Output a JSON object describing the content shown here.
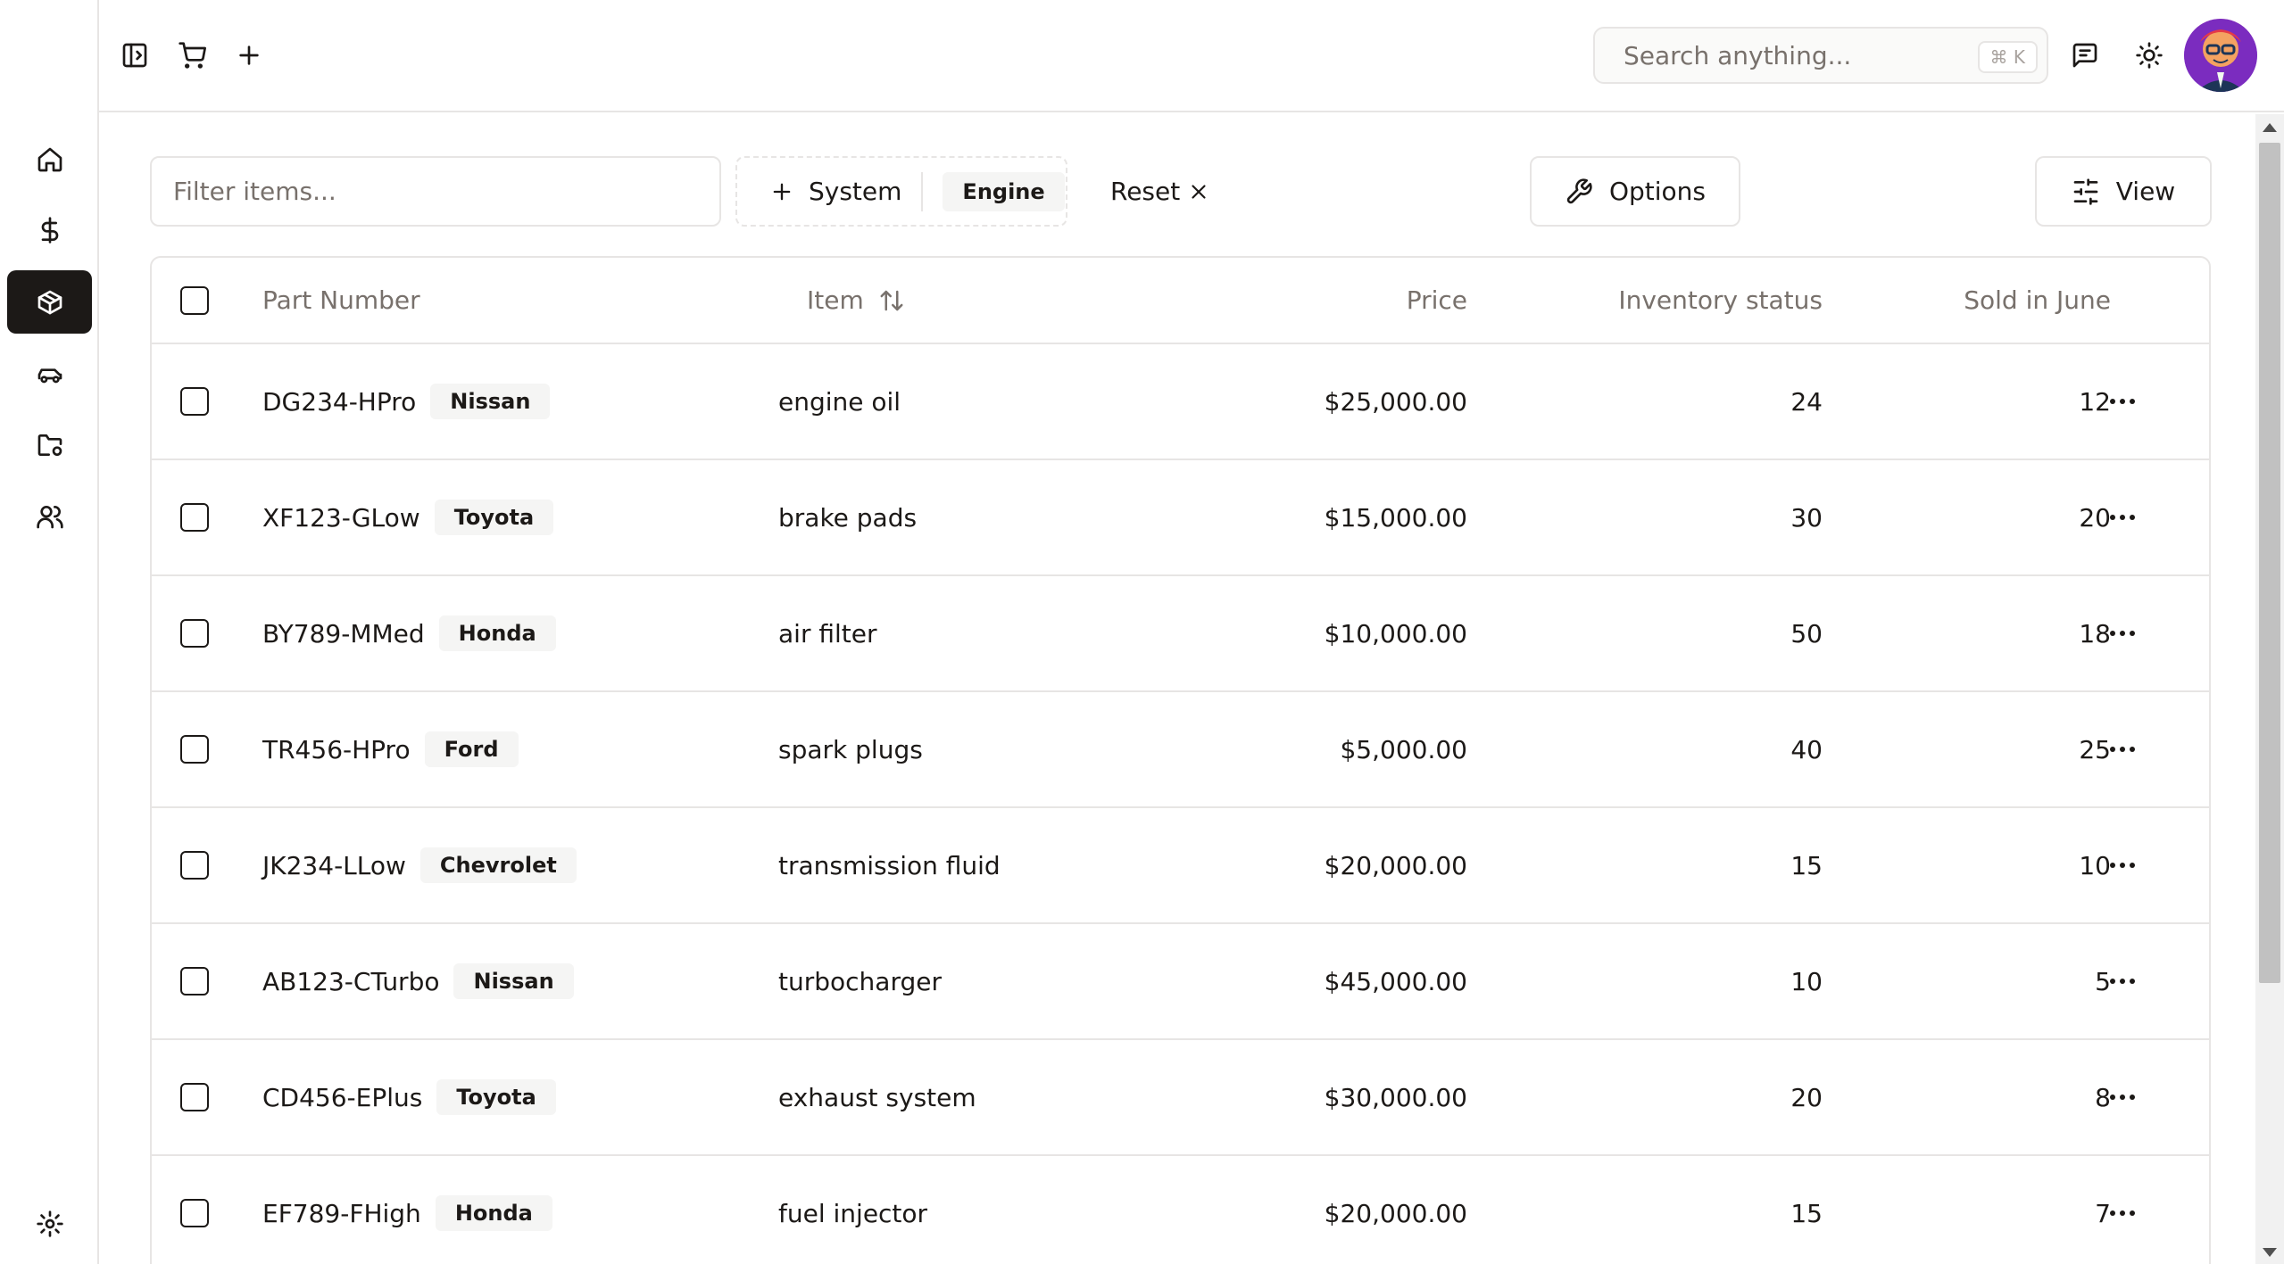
{
  "header": {
    "search_placeholder": "Search anything...",
    "search_shortcut": "⌘ K",
    "icons": [
      "sidebar-toggle-icon",
      "cart-icon",
      "plus-icon",
      "message-icon",
      "sun-icon"
    ]
  },
  "sidebar": {
    "items": [
      {
        "name": "home",
        "icon": "home-icon",
        "active": false
      },
      {
        "name": "billing",
        "icon": "dollar-icon",
        "active": false
      },
      {
        "name": "inventory",
        "icon": "package-icon",
        "active": true
      },
      {
        "name": "vehicles",
        "icon": "car-icon",
        "active": false
      },
      {
        "name": "folders",
        "icon": "folder-settings-icon",
        "active": false
      },
      {
        "name": "users",
        "icon": "users-icon",
        "active": false
      }
    ],
    "settings_icon": "gear-icon"
  },
  "toolbar": {
    "filter_placeholder": "Filter items...",
    "system_label": "System",
    "system_chip": "Engine",
    "reset_label": "Reset",
    "options_label": "Options",
    "view_label": "View"
  },
  "table": {
    "columns": {
      "part_number": "Part Number",
      "item": "Item",
      "price": "Price",
      "inventory": "Inventory status",
      "sold": "Sold in June"
    },
    "rows": [
      {
        "part": "DG234-HPro",
        "brand": "Nissan",
        "item": "engine oil",
        "price": "$25,000.00",
        "inventory": "24",
        "sold": "12"
      },
      {
        "part": "XF123-GLow",
        "brand": "Toyota",
        "item": "brake pads",
        "price": "$15,000.00",
        "inventory": "30",
        "sold": "20"
      },
      {
        "part": "BY789-MMed",
        "brand": "Honda",
        "item": "air filter",
        "price": "$10,000.00",
        "inventory": "50",
        "sold": "18"
      },
      {
        "part": "TR456-HPro",
        "brand": "Ford",
        "item": "spark plugs",
        "price": "$5,000.00",
        "inventory": "40",
        "sold": "25"
      },
      {
        "part": "JK234-LLow",
        "brand": "Chevrolet",
        "item": "transmission fluid",
        "price": "$20,000.00",
        "inventory": "15",
        "sold": "10"
      },
      {
        "part": "AB123-CTurbo",
        "brand": "Nissan",
        "item": "turbocharger",
        "price": "$45,000.00",
        "inventory": "10",
        "sold": "5"
      },
      {
        "part": "CD456-EPlus",
        "brand": "Toyota",
        "item": "exhaust system",
        "price": "$30,000.00",
        "inventory": "20",
        "sold": "8"
      },
      {
        "part": "EF789-FHigh",
        "brand": "Honda",
        "item": "fuel injector",
        "price": "$20,000.00",
        "inventory": "15",
        "sold": "7"
      }
    ]
  },
  "colors": {
    "accent": "#1c1917",
    "border": "#e7e5e4",
    "muted_text": "#78716c",
    "chip_bg": "#f5f5f4"
  }
}
